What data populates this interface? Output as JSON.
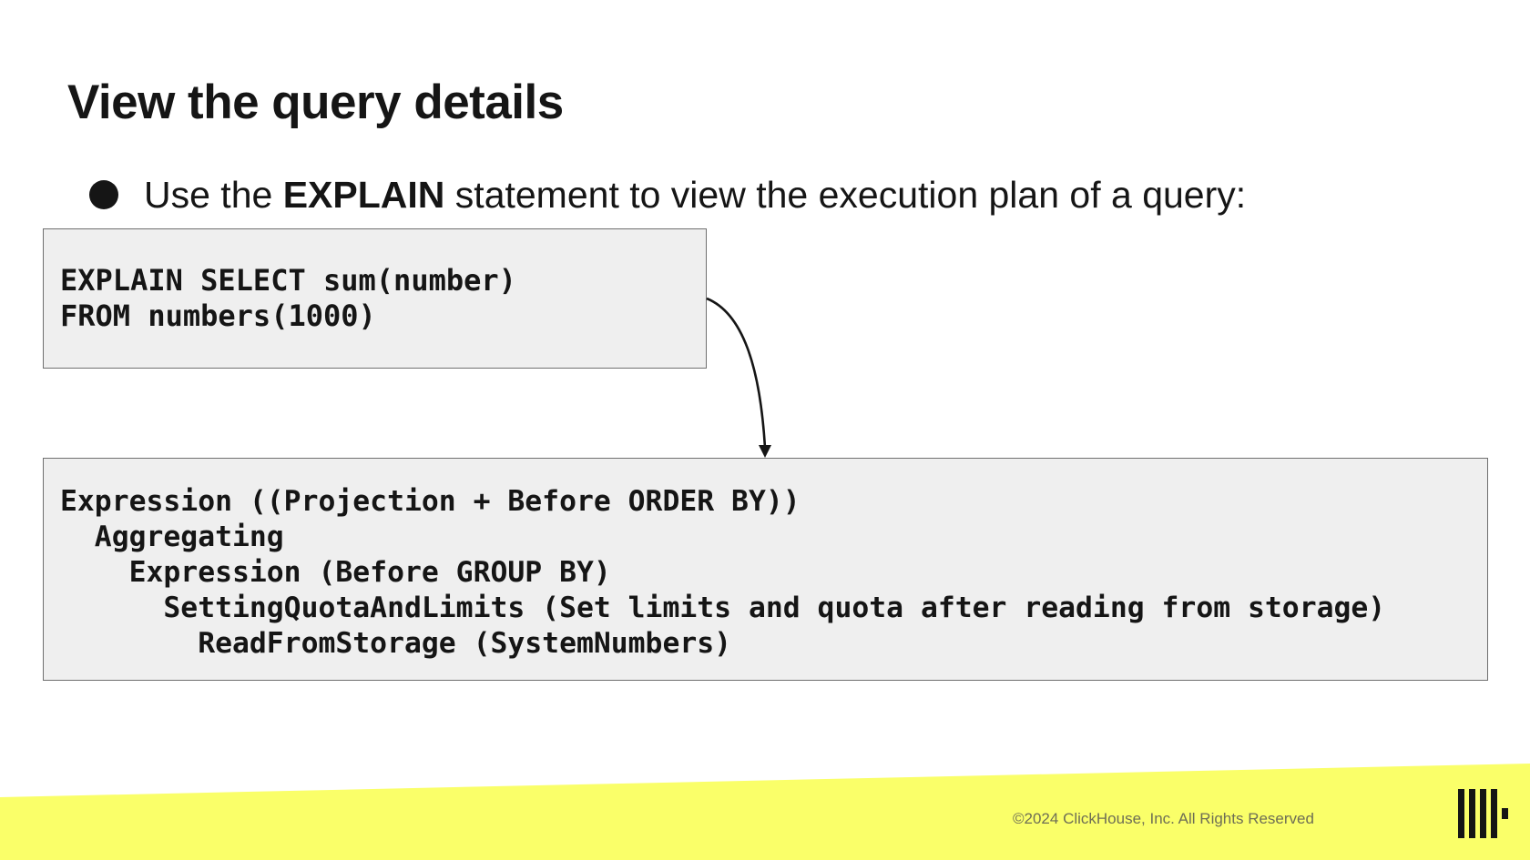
{
  "slide": {
    "title": "View the query details",
    "bullet": {
      "prefix": "Use the ",
      "keyword": "EXPLAIN",
      "suffix": " statement to view the execution plan of a query:"
    }
  },
  "query_box": {
    "lines": [
      "EXPLAIN SELECT sum(number)",
      "FROM numbers(1000)"
    ]
  },
  "plan_box": {
    "lines": [
      "Expression ((Projection + Before ORDER BY))",
      "  Aggregating",
      "    Expression (Before GROUP BY)",
      "      SettingQuotaAndLimits (Set limits and quota after reading from storage)",
      "        ReadFromStorage (SystemNumbers)"
    ]
  },
  "footer": {
    "copyright": "©2024 ClickHouse, Inc. All Rights Reserved",
    "band_color": "#faff69",
    "logo_icon": "clickhouse-logo-icon"
  }
}
